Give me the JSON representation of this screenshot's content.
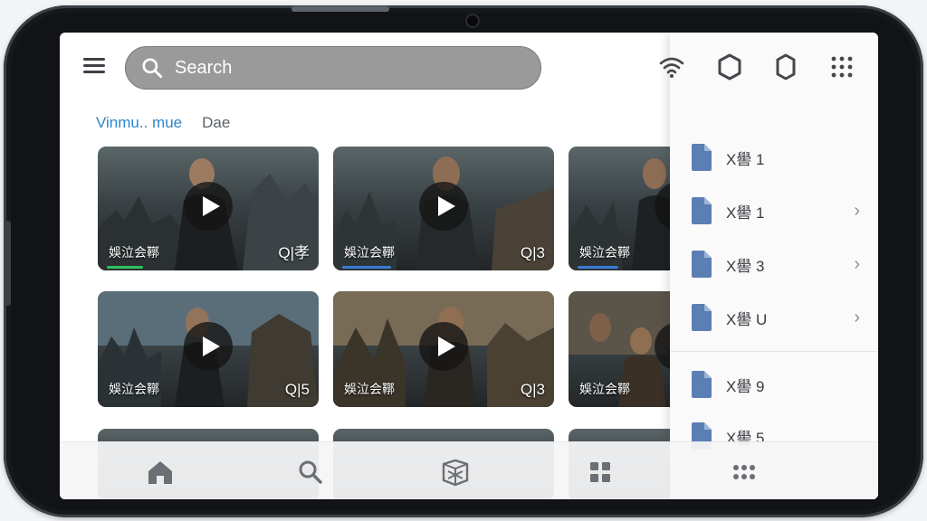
{
  "header": {
    "search_placeholder": "Search"
  },
  "tabs": [
    {
      "label": "Vinmu.. mue",
      "active": true
    },
    {
      "label": "Dae",
      "active": false
    }
  ],
  "videos": [
    {
      "title": "娛泣会鞹",
      "duration": "Q|孝",
      "progress": 0.18,
      "progress_color": "#2fbf5a"
    },
    {
      "title": "娛泣会鞹",
      "duration": "Q|3",
      "progress": 0.24,
      "progress_color": "#3a7bd5"
    },
    {
      "title": "娛泣会鞹",
      "duration": "",
      "progress": 0.2,
      "progress_color": "#3a7bd5"
    },
    {
      "title": "娛泣会鞹",
      "duration": "Q|5",
      "progress": 0,
      "progress_color": "#3a7bd5"
    },
    {
      "title": "娛泣会鞹",
      "duration": "Q|3",
      "progress": 0,
      "progress_color": "#3a7bd5"
    },
    {
      "title": "娛泣会鞹",
      "duration": "",
      "progress": 0,
      "progress_color": "#3a7bd5"
    }
  ],
  "files": [
    {
      "label": "X嚳 1",
      "chevron": false
    },
    {
      "label": "X嚳 1",
      "chevron": true
    },
    {
      "label": "X嚳 3",
      "chevron": true
    },
    {
      "label": "X嚳 U",
      "chevron": true
    },
    {
      "label": "X嚳 9",
      "chevron": false
    },
    {
      "label": "X嚳 5",
      "chevron": false
    }
  ],
  "top_icons": [
    "wifi-icon",
    "hexagon-outline-icon",
    "shield-icon",
    "app-grid-icon"
  ],
  "bottom_nav": [
    "home-icon",
    "search-icon",
    "cube-icon",
    "grid-icon",
    "more-dots-icon"
  ],
  "colors": {
    "accent": "#2e86c9",
    "file_icon": "#5b7fb5",
    "search_bg": "#9a9a9a"
  }
}
